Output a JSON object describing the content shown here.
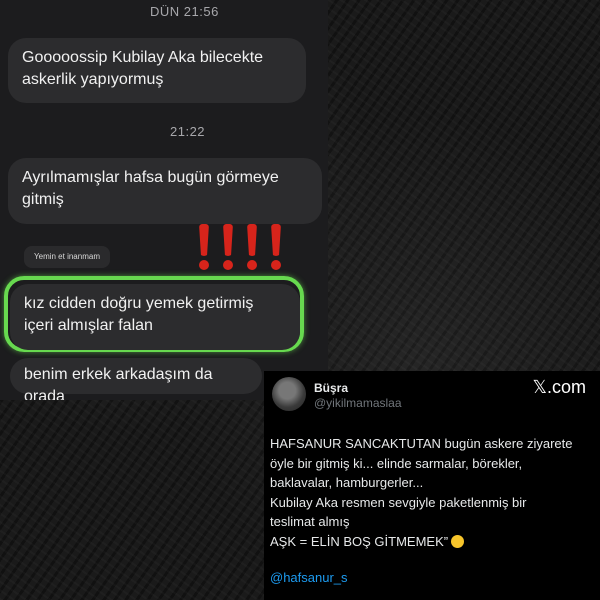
{
  "chat": {
    "timestamp_1": "DÜN 21:56",
    "message_1": "Gooooossip Kubilay Aka bilecekte askerlik yapıyormuş",
    "timestamp_2": "21:22",
    "message_2": "Ayrılmamışlar hafsa bugün görmeye gitmiş",
    "reply_chip": "Yemin et inanmam",
    "message_3": "kız cidden doğru yemek getirmiş içeri almışlar falan",
    "message_4": "benim erkek arkadaşım da orada"
  },
  "emphasis": {
    "marks": [
      "!",
      "!",
      "!",
      "!"
    ],
    "color": "#d7241b"
  },
  "highlight_color": "#67d94f",
  "tweet": {
    "name": "Büşra",
    "handle": "@yikilmamaslaa",
    "brand": "𝕏.com",
    "lines": [
      "HAFSANUR SANCAKTUTAN bugün askere ziyarete",
      "öyle bir gitmiş ki... elinde sarmalar, börekler,",
      "baklavalar, hamburgerler...",
      "Kubilay Aka resmen sevgiyle paketlenmiş bir",
      "teslimat almış",
      "AŞK = ELİN BOŞ GİTMEMEK”"
    ],
    "emoji": "hugging-face-emoji",
    "mention": "@hafsanur_s"
  }
}
